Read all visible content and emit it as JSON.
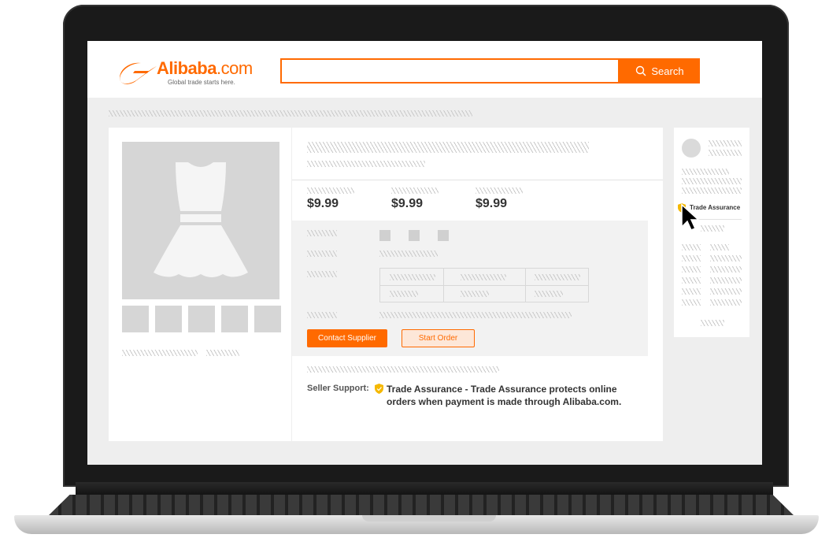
{
  "brand": {
    "logo_text": "Alibaba",
    "logo_suffix": ".com",
    "tagline": "Global trade starts here.",
    "accent_color": "#ff6a00"
  },
  "search": {
    "placeholder": "",
    "button_label": "Search",
    "icon": "search-icon"
  },
  "product": {
    "image_icon": "dress-icon",
    "prices": [
      "$9.99",
      "$9.99",
      "$9.99"
    ]
  },
  "actions": {
    "contact_supplier": "Contact Supplier",
    "start_order": "Start Order"
  },
  "seller_support": {
    "label": "Seller Support:",
    "text": "Trade Assurance - Trade Assurance protects online orders when payment is made through Alibaba.com.",
    "icon": "shield-icon"
  },
  "sidebar": {
    "badge_label": "Trade Assurance",
    "badge_icon": "shield-icon"
  },
  "cursor_icon": "cursor-arrow-icon"
}
